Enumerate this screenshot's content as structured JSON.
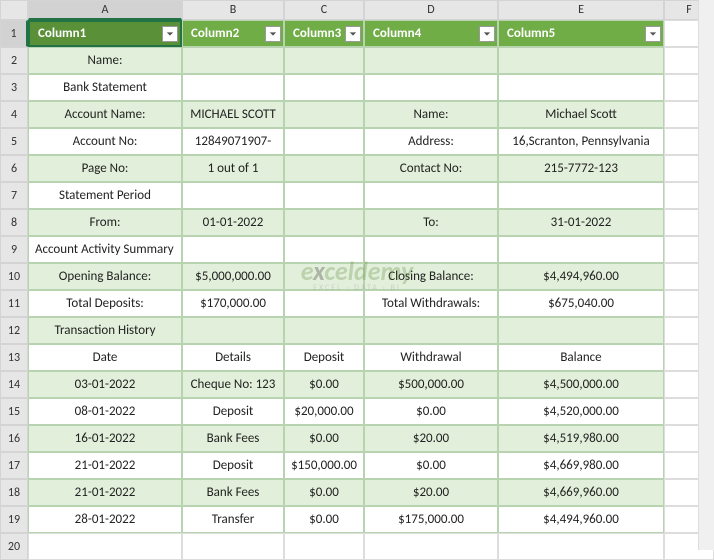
{
  "columns": [
    "A",
    "B",
    "C",
    "D",
    "E",
    "F"
  ],
  "rows": [
    "1",
    "2",
    "3",
    "4",
    "5",
    "6",
    "7",
    "8",
    "9",
    "10",
    "11",
    "12",
    "13",
    "14",
    "15",
    "16",
    "17",
    "18",
    "19",
    "20"
  ],
  "headers": {
    "c1": "Column1",
    "c2": "Column2",
    "c3": "Column3",
    "c4": "Column4",
    "c5": "Column5"
  },
  "bank": {
    "name_label": "Name:",
    "statement_label": "Bank Statement",
    "account_name_label": "Account Name:",
    "account_name_value": "MICHAEL SCOTT",
    "name_value": "Michael Scott",
    "account_no_label": "Account No:",
    "account_no_value": "12849071907-",
    "address_label": "Address:",
    "address_value": "16,Scranton, Pennsylvania",
    "page_no_label": "Page No:",
    "page_no_value": "1 out of 1",
    "contact_label": "Contact No:",
    "contact_value": "215-7772-123"
  },
  "period": {
    "title": "Statement Period",
    "from_label": "From:",
    "from_value": "01-01-2022",
    "to_label": "To:",
    "to_value": "31-01-2022"
  },
  "summary": {
    "title": "Account Activity Summary",
    "opening_label": "Opening Balance:",
    "opening_value": "$5,000,000.00",
    "closing_label": "Closing Balance:",
    "closing_value": "$4,494,960.00",
    "deposits_label": "Total Deposits:",
    "deposits_value": "$170,000.00",
    "withdrawals_label": "Total Withdrawals:",
    "withdrawals_value": "$675,040.00"
  },
  "history": {
    "title": "Transaction History",
    "h_date": "Date",
    "h_details": "Details",
    "h_deposit": "Deposit",
    "h_withdrawal": "Withdrawal",
    "h_balance": "Balance",
    "rows": [
      {
        "date": "03-01-2022",
        "details": "Cheque No: 123",
        "deposit": "$0.00",
        "withdrawal": "$500,000.00",
        "balance": "$4,500,000.00"
      },
      {
        "date": "08-01-2022",
        "details": "Deposit",
        "deposit": "$20,000.00",
        "withdrawal": "$0.00",
        "balance": "$4,520,000.00"
      },
      {
        "date": "16-01-2022",
        "details": "Bank Fees",
        "deposit": "$0.00",
        "withdrawal": "$20.00",
        "balance": "$4,519,980.00"
      },
      {
        "date": "21-01-2022",
        "details": "Deposit",
        "deposit": "$150,000.00",
        "withdrawal": "$0.00",
        "balance": "$4,669,980.00"
      },
      {
        "date": "21-01-2022",
        "details": "Bank Fees",
        "deposit": "$0.00",
        "withdrawal": "$20.00",
        "balance": "$4,669,960.00"
      },
      {
        "date": "28-01-2022",
        "details": "Transfer",
        "deposit": "$0.00",
        "withdrawal": "$175,000.00",
        "balance": "$4,494,960.00"
      }
    ]
  },
  "watermark": {
    "main_a": "e",
    "main_b": "x",
    "main_c": "celdemy",
    "sub": "EXCEL · DATA · BI"
  }
}
